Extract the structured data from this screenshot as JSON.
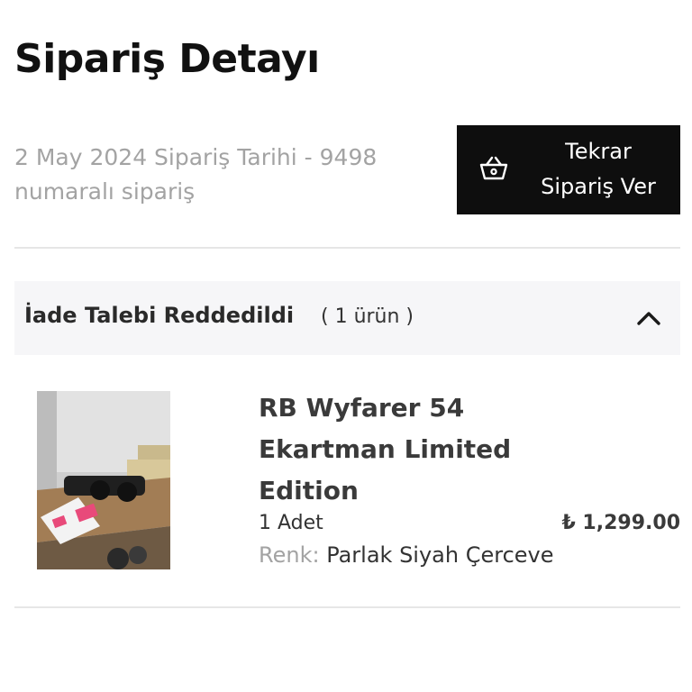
{
  "page": {
    "title": "Sipariş Detayı"
  },
  "order": {
    "meta_line1": "2 May 2024 Sipariş Tarihi - 9498",
    "meta_line2": "numaralı sipariş"
  },
  "reorder_button": {
    "label_line1": "Tekrar",
    "label_line2": "Sipariş Ver",
    "icon": "basket-icon"
  },
  "group": {
    "status": "İade Talebi Reddedildi",
    "count": "( 1 ürün )",
    "expanded": true,
    "toggle_icon": "chevron-up-icon"
  },
  "product": {
    "name_line1": "RB Wyfarer 54",
    "name_line2": "Ekartman Limited",
    "name_line3": "Edition",
    "quantity": "1 Adet",
    "price": "₺ 1,299.00",
    "color_label": "Renk:",
    "color_value": "Parlak Siyah Çerceve"
  },
  "colors": {
    "button_bg": "#0e0e0e",
    "muted_text": "#a3a3a3",
    "group_bg": "#f6f6f8"
  }
}
